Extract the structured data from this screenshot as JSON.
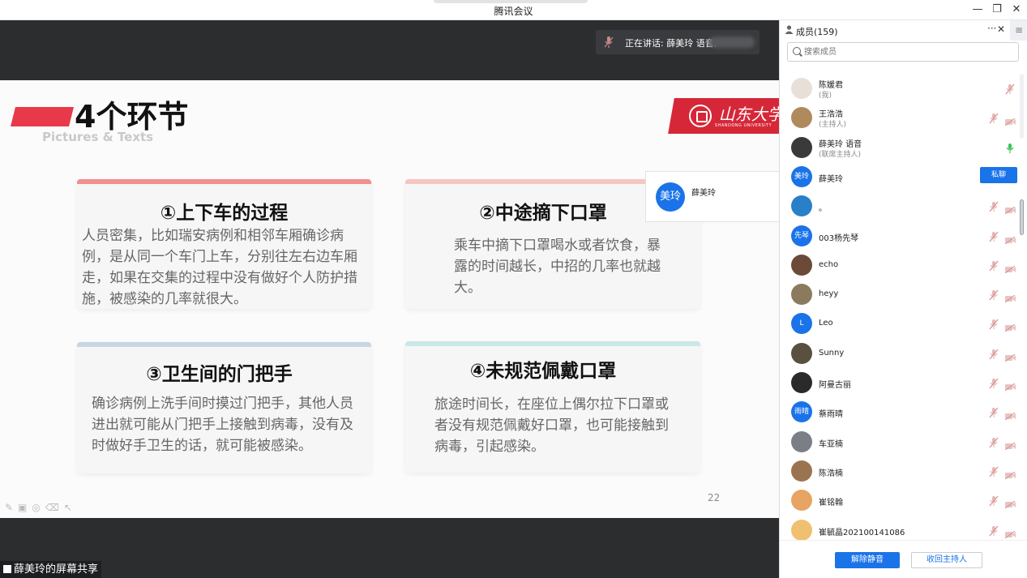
{
  "window": {
    "title": "腾讯会议"
  },
  "speaking": {
    "label": "正在讲话: 薛美玲 语音;"
  },
  "slide": {
    "heading": "4个环节",
    "subheading": "Pictures & Texts",
    "page_number": "22",
    "cards": [
      {
        "title": "①上下车的过程",
        "text": "人员密集，比如瑞安病例和相邻车厢确诊病例，是从同一个车门上车，分别往左右边车厢走，如果在交集的过程中没有做好个人防护措施，被感染的几率就很大。",
        "accent": "#f28e8e"
      },
      {
        "title": "②中途摘下口罩",
        "text": "乘车中摘下口罩喝水或者饮食，暴露的时间越长，中招的几率也就越大。",
        "accent": "#f5c7c0"
      },
      {
        "title": "③卫生间的门把手",
        "text": "确诊病例上洗手间时摸过门把手，其他人员进出就可能从门把手上接触到病毒，没有及时做好手卫生的话，就可能被感染。",
        "accent": "#c7d6e2"
      },
      {
        "title": "④未规范佩戴口罩",
        "text": "旅途时间长，在座位上偶尔拉下口罩或者没有规范佩戴好口罩，也可能接触到病毒，引起感染。",
        "accent": "#c9e8e6"
      }
    ]
  },
  "popup": {
    "avatar_text": "美玲",
    "name": "薛美玲"
  },
  "share_label": "薛美玲的屏幕共享",
  "panel": {
    "title": "成员(159)",
    "more": "···",
    "close": "✕",
    "menu": "≡",
    "search_placeholder": "搜索成员",
    "members": [
      {
        "name": "陈媛君",
        "role": "(我)",
        "avatar": "",
        "color": "#e8e0d8",
        "status": "muted"
      },
      {
        "name": "王浩浩",
        "role": "(主持人)",
        "avatar": "",
        "color": "#b08a5c",
        "status": "muted-cam"
      },
      {
        "name": "薛美玲 语音",
        "role": "(联席主持人)",
        "avatar": "",
        "color": "#3a3a3a",
        "status": "speaking"
      },
      {
        "name": "薛美玲",
        "role": "",
        "avatar": "美玲",
        "color": "#1a73e8",
        "status": "private"
      },
      {
        "name": "。",
        "role": "",
        "avatar": "",
        "color": "#2a7fc9",
        "status": "muted-cam"
      },
      {
        "name": "003杨先琴",
        "role": "",
        "avatar": "先琴",
        "color": "#1a73e8",
        "status": "muted-cam"
      },
      {
        "name": "echo",
        "role": "",
        "avatar": "",
        "color": "#6b4a3a",
        "status": "muted-cam"
      },
      {
        "name": "heyy",
        "role": "",
        "avatar": "",
        "color": "#8c7a5e",
        "status": "muted-cam"
      },
      {
        "name": "Leo",
        "role": "",
        "avatar": "L",
        "color": "#1a73e8",
        "status": "muted-cam"
      },
      {
        "name": "Sunny",
        "role": "",
        "avatar": "",
        "color": "#5a5040",
        "status": "muted-cam"
      },
      {
        "name": "阿曼古丽",
        "role": "",
        "avatar": "",
        "color": "#2a2a2a",
        "status": "muted-cam"
      },
      {
        "name": "蔡雨晴",
        "role": "",
        "avatar": "雨晴",
        "color": "#1a73e8",
        "status": "muted-cam"
      },
      {
        "name": "车亚楠",
        "role": "",
        "avatar": "",
        "color": "#7a7f86",
        "status": "muted-cam"
      },
      {
        "name": "陈浩楠",
        "role": "",
        "avatar": "",
        "color": "#9a7450",
        "status": "muted-cam"
      },
      {
        "name": "崔铭翰",
        "role": "",
        "avatar": "",
        "color": "#e7a462",
        "status": "muted-cam"
      },
      {
        "name": "崔毓晶202100141086",
        "role": "",
        "avatar": "",
        "color": "#f0c070",
        "status": "muted-cam"
      }
    ],
    "private_chat_label": "私聊",
    "unmute_all": "解除静音",
    "revoke_host": "收回主持人"
  }
}
